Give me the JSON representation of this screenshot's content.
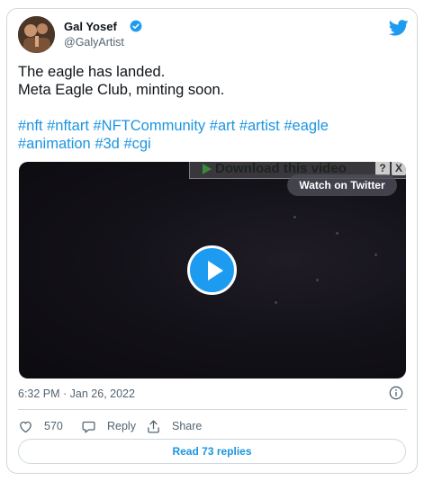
{
  "author": {
    "name": "Gal Yosef",
    "handle": "@GalyArtist",
    "verified": true
  },
  "tweet": {
    "lines": [
      "The eagle has landed.",
      "Meta Eagle Club, minting soon."
    ],
    "hashtag_rows": [
      [
        "#nft",
        "#nftart",
        "#NFTCommunity",
        "#art",
        "#artist",
        "#eagle"
      ],
      [
        "#animation",
        "#3d",
        "#cgi"
      ]
    ],
    "timestamp": "6:32 PM · Jan 26, 2022"
  },
  "video": {
    "download_label": "Download this video",
    "help_label": "?",
    "close_label": "X",
    "watch_label": "Watch on Twitter"
  },
  "actions": {
    "like_count": "570",
    "reply_label": "Reply",
    "share_label": "Share"
  },
  "read_replies_label": "Read 73 replies",
  "colors": {
    "accent": "#1d9bf0",
    "link": "#1b95e0",
    "text": "#0f1419",
    "muted": "#536471",
    "border": "#cfd9de"
  },
  "icons": [
    "avatar",
    "verified-badge-icon",
    "twitter-bird-icon",
    "play-icon",
    "info-icon",
    "heart-icon",
    "reply-bubble-icon",
    "share-icon"
  ]
}
